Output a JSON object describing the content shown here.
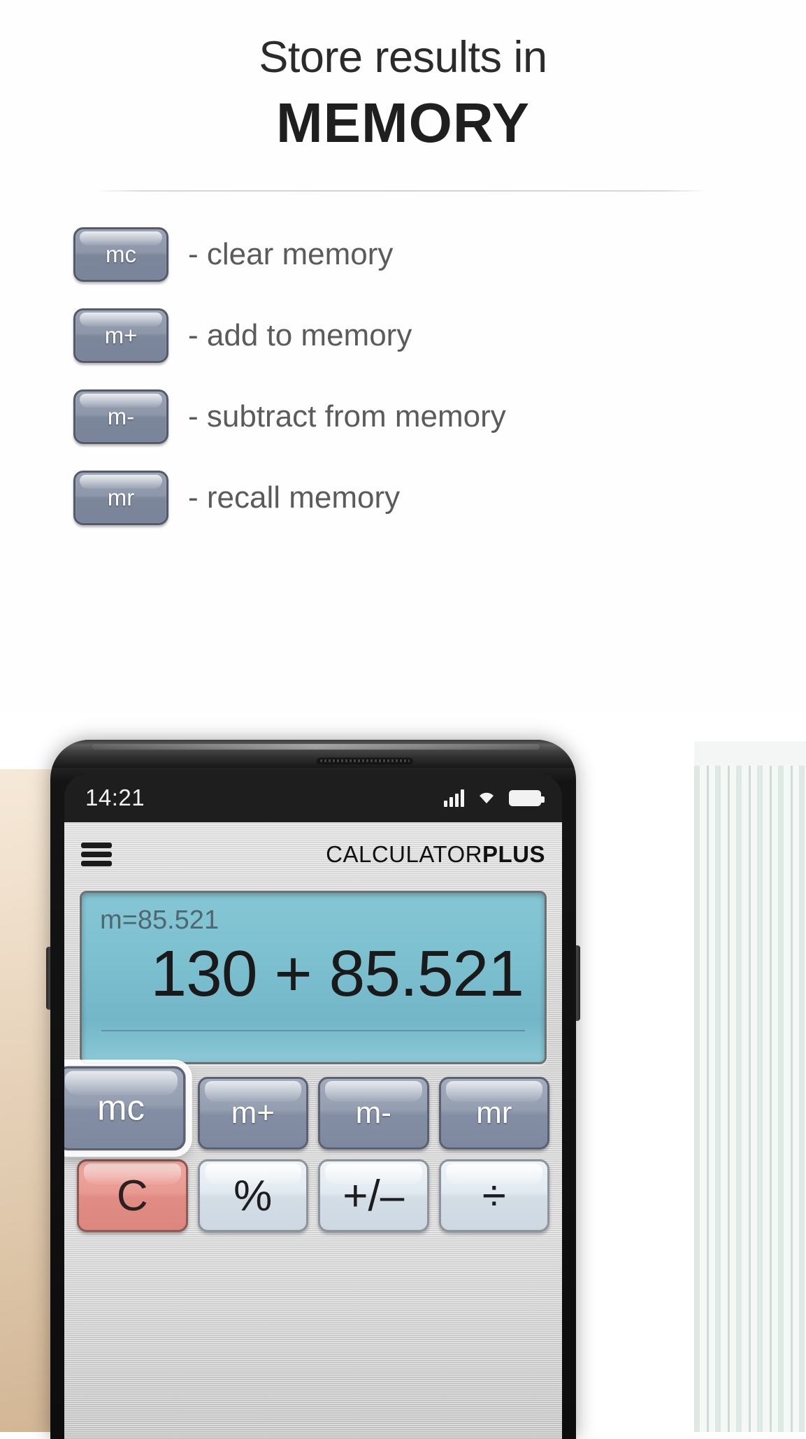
{
  "promo": {
    "headline_line1": "Store results in",
    "headline_line2": "MEMORY",
    "legend": [
      {
        "key": "mc",
        "description": "- clear memory"
      },
      {
        "key": "m+",
        "description": "- add to memory"
      },
      {
        "key": "m-",
        "description": "- subtract from memory"
      },
      {
        "key": "mr",
        "description": "- recall memory"
      }
    ]
  },
  "phone": {
    "statusbar": {
      "time": "14:21",
      "signal_icon": "cellular-signal-icon",
      "wifi_icon": "wifi-icon",
      "battery_icon": "battery-full-icon"
    },
    "app": {
      "menu_icon": "hamburger-menu-icon",
      "brand_light": "CALCULATOR",
      "brand_bold": "PLUS",
      "display": {
        "memory_indicator": "m=85.521",
        "expression": "130 + 85.521"
      },
      "keys_memory": [
        {
          "label": "mc",
          "highlighted": true
        },
        {
          "label": "m+",
          "highlighted": false
        },
        {
          "label": "m-",
          "highlighted": false
        },
        {
          "label": "mr",
          "highlighted": false
        }
      ],
      "keys_row2": [
        {
          "label": "C",
          "style": "clear"
        },
        {
          "label": "%",
          "style": "func"
        },
        {
          "label": "+/–",
          "style": "func"
        },
        {
          "label": "÷",
          "style": "func"
        }
      ]
    }
  },
  "colors": {
    "display_teal": "#7cc0d0",
    "memory_key": "#949eb1",
    "clear_key": "#e89a92",
    "func_key": "#e2eaf1",
    "headline": "#2b2b2b",
    "legend_text": "#5b5b5b"
  }
}
